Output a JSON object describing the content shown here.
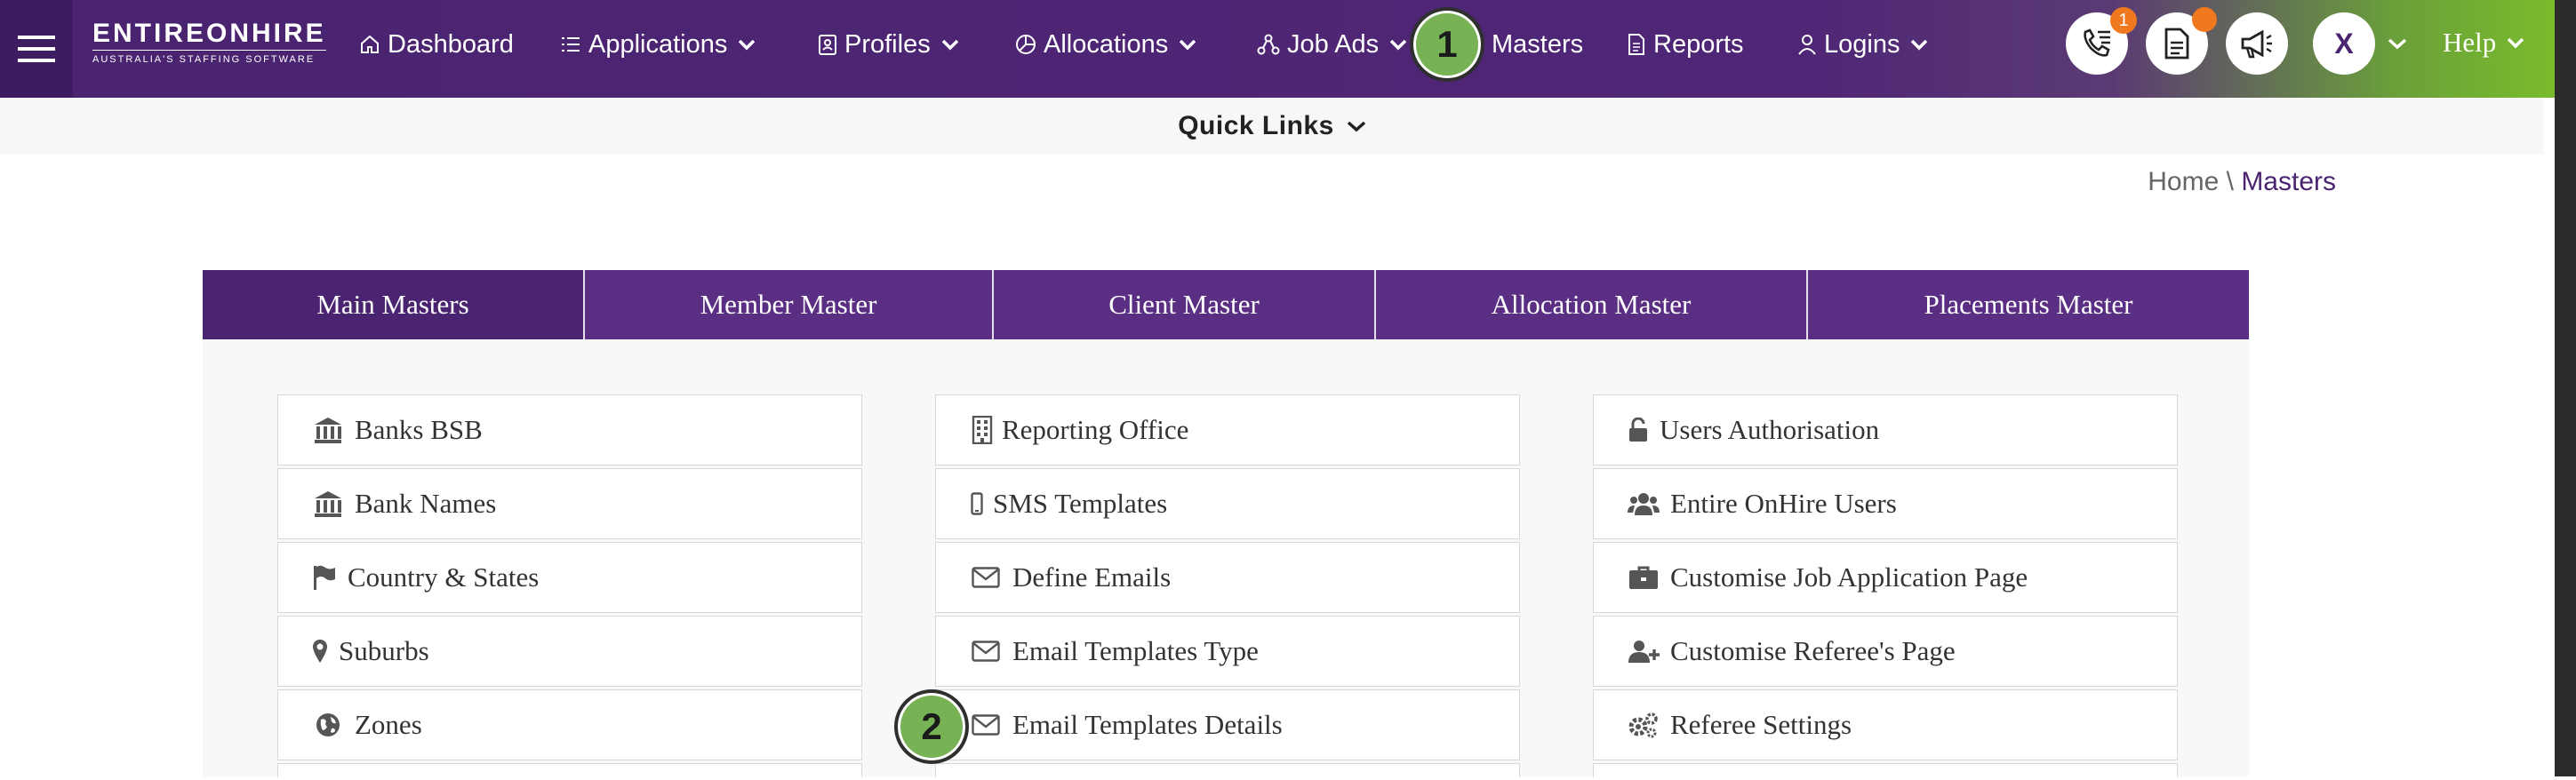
{
  "brand": {
    "name": "ENTIREONHIRE",
    "tagline": "AUSTRALIA'S STAFFING SOFTWARE"
  },
  "nav": {
    "dashboard": "Dashboard",
    "applications": "Applications",
    "profiles": "Profiles",
    "allocations": "Allocations",
    "job_ads": "Job Ads",
    "masters": "Masters",
    "reports": "Reports",
    "logins": "Logins"
  },
  "header_icons": {
    "calls_badge": "1",
    "user_initial": "X",
    "help": "Help",
    "icons": [
      "phone-list-icon",
      "document-icon",
      "megaphone-icon"
    ]
  },
  "quick_links": {
    "label": "Quick Links"
  },
  "breadcrumb": {
    "home": "Home",
    "separator": "\\",
    "current": "Masters"
  },
  "tabs": [
    {
      "label": "Main Masters",
      "active": true
    },
    {
      "label": "Member Master"
    },
    {
      "label": "Client Master"
    },
    {
      "label": "Allocation Master"
    },
    {
      "label": "Placements Master"
    }
  ],
  "columns": [
    [
      {
        "label": "Banks BSB",
        "icon": "bank-icon"
      },
      {
        "label": "Bank Names",
        "icon": "bank-icon"
      },
      {
        "label": "Country & States",
        "icon": "flag-icon"
      },
      {
        "label": "Suburbs",
        "icon": "map-marker-icon"
      },
      {
        "label": "Zones",
        "icon": "globe-icon"
      }
    ],
    [
      {
        "label": "Reporting Office",
        "icon": "building-icon"
      },
      {
        "label": "SMS Templates",
        "icon": "mobile-icon"
      },
      {
        "label": "Define Emails",
        "icon": "envelope-icon"
      },
      {
        "label": "Email Templates Type",
        "icon": "envelope-icon"
      },
      {
        "label": "Email Templates Details",
        "icon": "envelope-icon"
      }
    ],
    [
      {
        "label": "Users Authorisation",
        "icon": "unlock-icon"
      },
      {
        "label": "Entire OnHire Users",
        "icon": "users-icon"
      },
      {
        "label": "Customise Job Application Page",
        "icon": "briefcase-icon"
      },
      {
        "label": "Customise Referee's Page",
        "icon": "user-plus-icon"
      },
      {
        "label": "Referee Settings",
        "icon": "cogs-icon"
      }
    ]
  ],
  "markers": [
    "1",
    "2"
  ],
  "colors": {
    "primary": "#4a2470",
    "tab": "#5a2e83",
    "accent_green": "#7cbf2a",
    "marker": "#77b255",
    "badge": "#f0781e"
  }
}
